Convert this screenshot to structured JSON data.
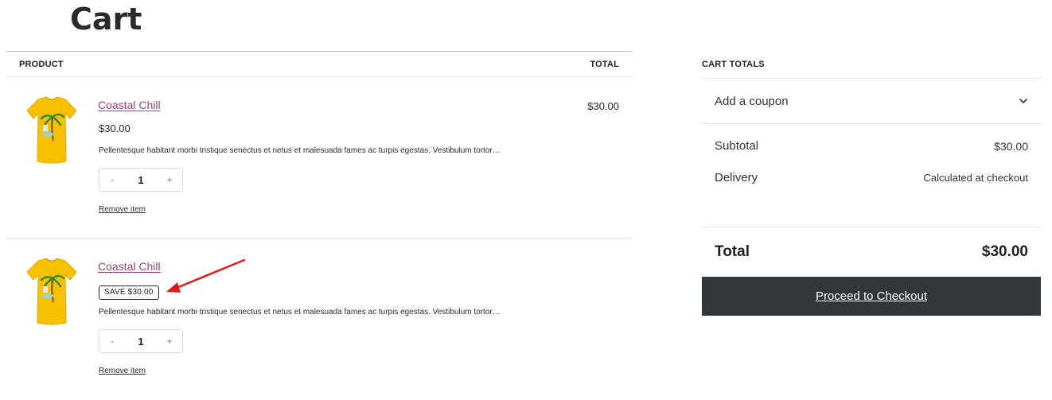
{
  "page": {
    "title": "Cart"
  },
  "table": {
    "product_header": "PRODUCT",
    "total_header": "TOTAL"
  },
  "items": [
    {
      "name": "Coastal Chill",
      "price": "$30.00",
      "badge": "",
      "description": "Pellentesque habitant morbi tristique senectus et netus et malesuada fames ac turpis egestas. Vestibulum tortor…",
      "qty_minus": "-",
      "qty_value": "1",
      "qty_plus": "+",
      "remove_label": "Remove item",
      "line_total": "$30.00"
    },
    {
      "name": "Coastal Chill",
      "price": "",
      "badge": "SAVE $30.00",
      "description": "Pellentesque habitant morbi tristique senectus et netus et malesuada fames ac turpis egestas. Vestibulum tortor…",
      "qty_minus": "-",
      "qty_value": "1",
      "qty_plus": "+",
      "remove_label": "Remove item",
      "line_total": ""
    }
  ],
  "totals": {
    "heading": "CART TOTALS",
    "coupon_label": "Add a coupon",
    "subtotal_label": "Subtotal",
    "subtotal_value": "$30.00",
    "delivery_label": "Delivery",
    "delivery_value": "Calculated at checkout",
    "total_label": "Total",
    "total_value": "$30.00",
    "checkout_label": "Proceed to Checkout"
  },
  "colors": {
    "link": "#a33f79",
    "checkout_bg": "#32373c",
    "annotation_arrow": "#e01b1b",
    "shirt": "#f7c100"
  },
  "icons": {
    "coupon_toggle": "chevron-down-icon",
    "annotation": "red-arrow-icon"
  }
}
